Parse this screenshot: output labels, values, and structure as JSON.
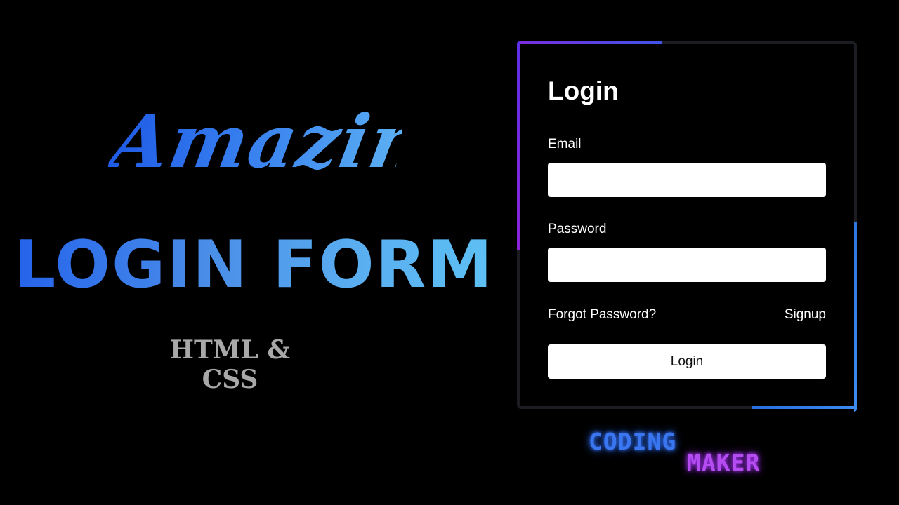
{
  "promo": {
    "script_word": "Amazing",
    "title": "LOGIN FORM",
    "subtitle": "HTML & CSS"
  },
  "login_card": {
    "title": "Login",
    "email_label": "Email",
    "email_value": "",
    "password_label": "Password",
    "password_value": "",
    "forgot_link": "Forgot Password?",
    "signup_link": "Signup",
    "submit_label": "Login"
  },
  "brand": {
    "line1": "CODING",
    "line2": "MAKER"
  },
  "colors": {
    "background": "#000000",
    "title_gradient_start": "#2563eb",
    "title_gradient_end": "#5ec2f4",
    "subtitle": "#a8a8a8",
    "card_border": "#1b1d22",
    "accent_purple": "#7b2de0",
    "accent_blue": "#3d8af0",
    "brand_blue": "#3a76f0",
    "brand_purple": "#b44cf2"
  }
}
